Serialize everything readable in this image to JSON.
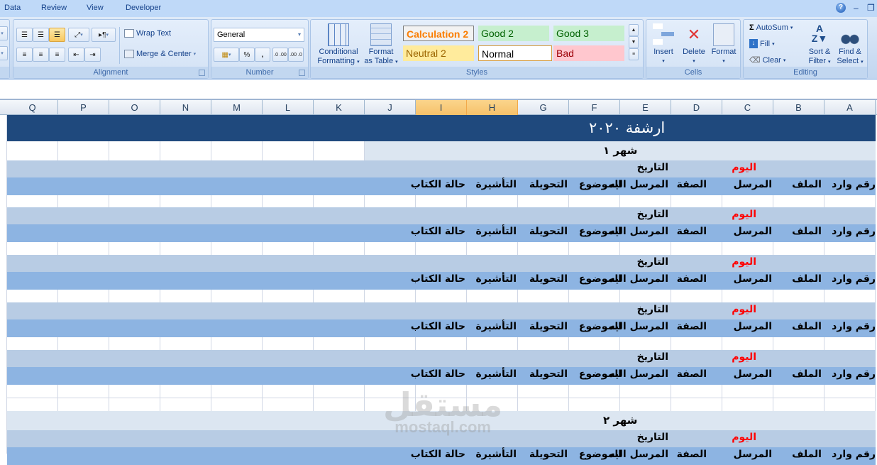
{
  "ribbon_tabs": [
    "Data",
    "Review",
    "View",
    "Developer"
  ],
  "window_controls": {
    "help": "?",
    "minimize": "–",
    "restore": "❐"
  },
  "alignment_group": {
    "label": "Alignment",
    "wrap_text": "Wrap Text",
    "merge_center": "Merge & Center"
  },
  "number_group": {
    "label": "Number",
    "format_value": "General",
    "percent": "%",
    "comma": ",",
    "inc_decimal": ".0 .00",
    "dec_decimal": ".00 .0"
  },
  "styles_group": {
    "label": "Styles",
    "conditional_formatting": [
      "Conditional",
      "Formatting"
    ],
    "format_as_table": [
      "Format",
      "as Table"
    ],
    "styles": [
      {
        "name": "Calculation 2",
        "bg": "#f2f2f2",
        "color": "#fa7d00",
        "border": "#7f7f7f"
      },
      {
        "name": "Good 2",
        "bg": "#c6efce",
        "color": "#006100"
      },
      {
        "name": "Good 3",
        "bg": "#c6efce",
        "color": "#006100"
      },
      {
        "name": "Neutral 2",
        "bg": "#ffeb9c",
        "color": "#9c6500"
      },
      {
        "name": "Normal",
        "bg": "#ffffff",
        "color": "#000000",
        "border": "#d69a3a"
      },
      {
        "name": "Bad",
        "bg": "#ffc7ce",
        "color": "#9c0006"
      }
    ]
  },
  "cells_group": {
    "label": "Cells",
    "insert": "Insert",
    "delete": "Delete",
    "format": "Format"
  },
  "editing_group": {
    "label": "Editing",
    "autosum": "AutoSum",
    "fill": "Fill",
    "clear": "Clear",
    "sort_filter": [
      "Sort &",
      "Filter"
    ],
    "find_select": [
      "Find &",
      "Select"
    ]
  },
  "columns": [
    "Q",
    "P",
    "O",
    "N",
    "M",
    "L",
    "K",
    "J",
    "I",
    "H",
    "G",
    "F",
    "E",
    "D",
    "C",
    "B",
    "A"
  ],
  "selected_columns": [
    "I",
    "H"
  ],
  "sheet": {
    "title": "ارشفة ٢٠٢٠",
    "months": [
      "شهر ١",
      "شهر ٢"
    ],
    "day_label": "اليوم",
    "date_label": "التاريخ",
    "headers": [
      "رقم وارد",
      "الملف",
      "المرسل",
      "الصفة",
      "المرسل اليه",
      "الموضوع",
      "التحويلة",
      "التأشيرة",
      "حالة الكتاب"
    ]
  },
  "watermark": {
    "arabic": "مستقل",
    "latin": "mostaql.com"
  }
}
